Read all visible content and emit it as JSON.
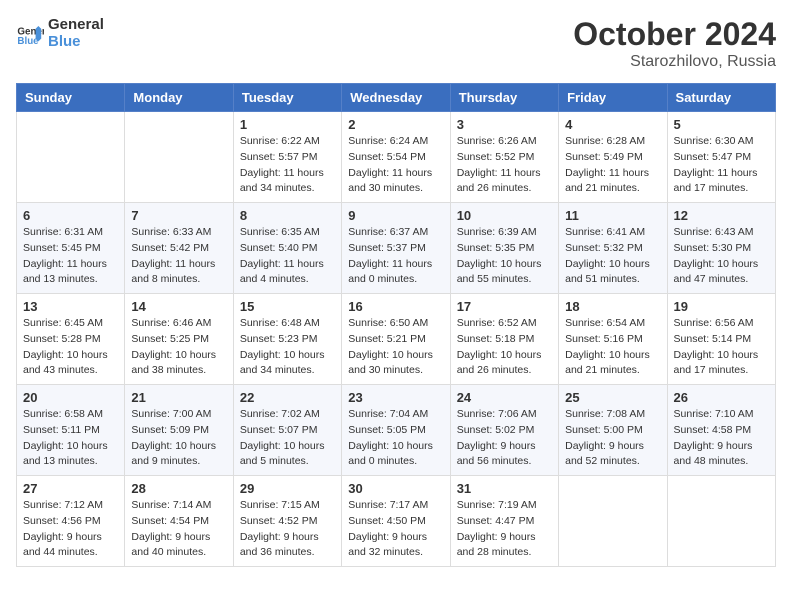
{
  "logo": {
    "line1": "General",
    "line2": "Blue"
  },
  "title": "October 2024",
  "location": "Starozhilovo, Russia",
  "weekdays": [
    "Sunday",
    "Monday",
    "Tuesday",
    "Wednesday",
    "Thursday",
    "Friday",
    "Saturday"
  ],
  "weeks": [
    [
      null,
      null,
      {
        "day": "1",
        "sunrise": "6:22 AM",
        "sunset": "5:57 PM",
        "daylight": "11 hours and 34 minutes."
      },
      {
        "day": "2",
        "sunrise": "6:24 AM",
        "sunset": "5:54 PM",
        "daylight": "11 hours and 30 minutes."
      },
      {
        "day": "3",
        "sunrise": "6:26 AM",
        "sunset": "5:52 PM",
        "daylight": "11 hours and 26 minutes."
      },
      {
        "day": "4",
        "sunrise": "6:28 AM",
        "sunset": "5:49 PM",
        "daylight": "11 hours and 21 minutes."
      },
      {
        "day": "5",
        "sunrise": "6:30 AM",
        "sunset": "5:47 PM",
        "daylight": "11 hours and 17 minutes."
      }
    ],
    [
      {
        "day": "6",
        "sunrise": "6:31 AM",
        "sunset": "5:45 PM",
        "daylight": "11 hours and 13 minutes."
      },
      {
        "day": "7",
        "sunrise": "6:33 AM",
        "sunset": "5:42 PM",
        "daylight": "11 hours and 8 minutes."
      },
      {
        "day": "8",
        "sunrise": "6:35 AM",
        "sunset": "5:40 PM",
        "daylight": "11 hours and 4 minutes."
      },
      {
        "day": "9",
        "sunrise": "6:37 AM",
        "sunset": "5:37 PM",
        "daylight": "11 hours and 0 minutes."
      },
      {
        "day": "10",
        "sunrise": "6:39 AM",
        "sunset": "5:35 PM",
        "daylight": "10 hours and 55 minutes."
      },
      {
        "day": "11",
        "sunrise": "6:41 AM",
        "sunset": "5:32 PM",
        "daylight": "10 hours and 51 minutes."
      },
      {
        "day": "12",
        "sunrise": "6:43 AM",
        "sunset": "5:30 PM",
        "daylight": "10 hours and 47 minutes."
      }
    ],
    [
      {
        "day": "13",
        "sunrise": "6:45 AM",
        "sunset": "5:28 PM",
        "daylight": "10 hours and 43 minutes."
      },
      {
        "day": "14",
        "sunrise": "6:46 AM",
        "sunset": "5:25 PM",
        "daylight": "10 hours and 38 minutes."
      },
      {
        "day": "15",
        "sunrise": "6:48 AM",
        "sunset": "5:23 PM",
        "daylight": "10 hours and 34 minutes."
      },
      {
        "day": "16",
        "sunrise": "6:50 AM",
        "sunset": "5:21 PM",
        "daylight": "10 hours and 30 minutes."
      },
      {
        "day": "17",
        "sunrise": "6:52 AM",
        "sunset": "5:18 PM",
        "daylight": "10 hours and 26 minutes."
      },
      {
        "day": "18",
        "sunrise": "6:54 AM",
        "sunset": "5:16 PM",
        "daylight": "10 hours and 21 minutes."
      },
      {
        "day": "19",
        "sunrise": "6:56 AM",
        "sunset": "5:14 PM",
        "daylight": "10 hours and 17 minutes."
      }
    ],
    [
      {
        "day": "20",
        "sunrise": "6:58 AM",
        "sunset": "5:11 PM",
        "daylight": "10 hours and 13 minutes."
      },
      {
        "day": "21",
        "sunrise": "7:00 AM",
        "sunset": "5:09 PM",
        "daylight": "10 hours and 9 minutes."
      },
      {
        "day": "22",
        "sunrise": "7:02 AM",
        "sunset": "5:07 PM",
        "daylight": "10 hours and 5 minutes."
      },
      {
        "day": "23",
        "sunrise": "7:04 AM",
        "sunset": "5:05 PM",
        "daylight": "10 hours and 0 minutes."
      },
      {
        "day": "24",
        "sunrise": "7:06 AM",
        "sunset": "5:02 PM",
        "daylight": "9 hours and 56 minutes."
      },
      {
        "day": "25",
        "sunrise": "7:08 AM",
        "sunset": "5:00 PM",
        "daylight": "9 hours and 52 minutes."
      },
      {
        "day": "26",
        "sunrise": "7:10 AM",
        "sunset": "4:58 PM",
        "daylight": "9 hours and 48 minutes."
      }
    ],
    [
      {
        "day": "27",
        "sunrise": "7:12 AM",
        "sunset": "4:56 PM",
        "daylight": "9 hours and 44 minutes."
      },
      {
        "day": "28",
        "sunrise": "7:14 AM",
        "sunset": "4:54 PM",
        "daylight": "9 hours and 40 minutes."
      },
      {
        "day": "29",
        "sunrise": "7:15 AM",
        "sunset": "4:52 PM",
        "daylight": "9 hours and 36 minutes."
      },
      {
        "day": "30",
        "sunrise": "7:17 AM",
        "sunset": "4:50 PM",
        "daylight": "9 hours and 32 minutes."
      },
      {
        "day": "31",
        "sunrise": "7:19 AM",
        "sunset": "4:47 PM",
        "daylight": "9 hours and 28 minutes."
      },
      null,
      null
    ]
  ]
}
